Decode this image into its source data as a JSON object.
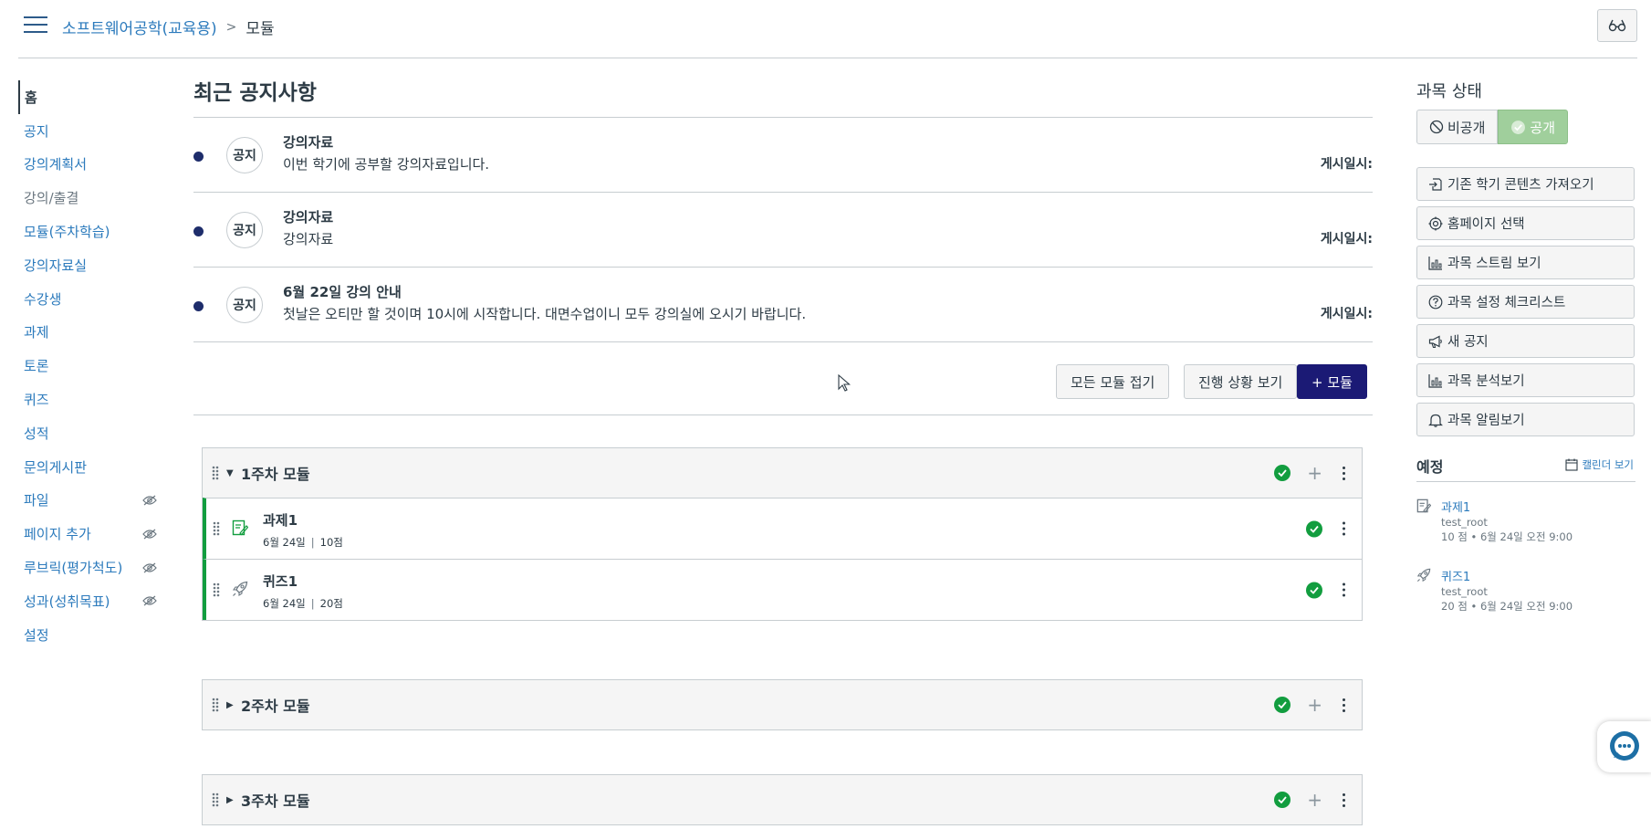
{
  "header": {
    "course_name": "소프트웨어공학(교육용)",
    "current_page": "모듈"
  },
  "nav": {
    "items": [
      {
        "label": "홈",
        "state": "active"
      },
      {
        "label": "공지"
      },
      {
        "label": "강의계획서"
      },
      {
        "label": "강의/출결",
        "state": "disabled"
      },
      {
        "label": "모듈(주차학습)"
      },
      {
        "label": "강의자료실"
      },
      {
        "label": "수강생"
      },
      {
        "label": "과제"
      },
      {
        "label": "토론"
      },
      {
        "label": "퀴즈"
      },
      {
        "label": "성적"
      },
      {
        "label": "문의게시판"
      },
      {
        "label": "파일",
        "hidden": true
      },
      {
        "label": "페이지 추가",
        "hidden": true
      },
      {
        "label": "루브릭(평가척도)",
        "hidden": true
      },
      {
        "label": "성과(성취목표)",
        "hidden": true
      },
      {
        "label": "설정"
      }
    ]
  },
  "announcements": {
    "title": "최근 공지사항",
    "items": [
      {
        "badge": "공지",
        "title": "강의자료",
        "body": "이번 학기에 공부할 강의자료입니다.",
        "posted": "게시일시:"
      },
      {
        "badge": "공지",
        "title": "강의자료",
        "body": "강의자료",
        "posted": "게시일시:"
      },
      {
        "badge": "공지",
        "title": "6월 22일 강의 안내",
        "body": "첫날은 오티만 할 것이며 10시에 시작합니다. 대면수업이니 모두 강의실에 오시기 바랍니다.",
        "posted": "게시일시:"
      }
    ]
  },
  "toolbar": {
    "collapse_all": "모든 모듈 접기",
    "view_progress": "진행 상황 보기",
    "add_module": "+ 모듈"
  },
  "modules": [
    {
      "title": "1주차 모듈",
      "expanded": true,
      "items": [
        {
          "type": "assignment",
          "title": "과제1",
          "date": "6월 24일",
          "points": "10점"
        },
        {
          "type": "quiz",
          "title": "퀴즈1",
          "date": "6월 24일",
          "points": "20점"
        }
      ]
    },
    {
      "title": "2주차 모듈",
      "expanded": false
    },
    {
      "title": "3주차 모듈",
      "expanded": false
    }
  ],
  "course_status": {
    "title": "과목 상태",
    "unpublished": "비공개",
    "published": "공개"
  },
  "sidebar_actions": [
    {
      "icon": "import-icon",
      "label": "기존 학기 콘텐츠 가져오기"
    },
    {
      "icon": "target-icon",
      "label": "홈페이지 선택"
    },
    {
      "icon": "chart-icon",
      "label": "과목 스트림 보기"
    },
    {
      "icon": "question-icon",
      "label": "과목 설정 체크리스트"
    },
    {
      "icon": "megaphone-icon",
      "label": "새 공지"
    },
    {
      "icon": "chart-icon",
      "label": "과목 분석보기"
    },
    {
      "icon": "bell-icon",
      "label": "과목 알림보기"
    }
  ],
  "coming_up": {
    "title": "예정",
    "calendar_link": "캘린더 보기",
    "items": [
      {
        "icon": "assignment-icon",
        "title": "과제1",
        "course": "test_root",
        "due": "10 점 • 6월 24일 오전 9:00"
      },
      {
        "icon": "quiz-icon",
        "title": "퀴즈1",
        "course": "test_root",
        "due": "20 점 • 6월 24일 오전 9:00"
      }
    ]
  },
  "colors": {
    "link": "#2b7abc",
    "primary_button": "#1b1a75",
    "published_green": "#129d3f",
    "published_toggle": "#a0cf9c"
  }
}
